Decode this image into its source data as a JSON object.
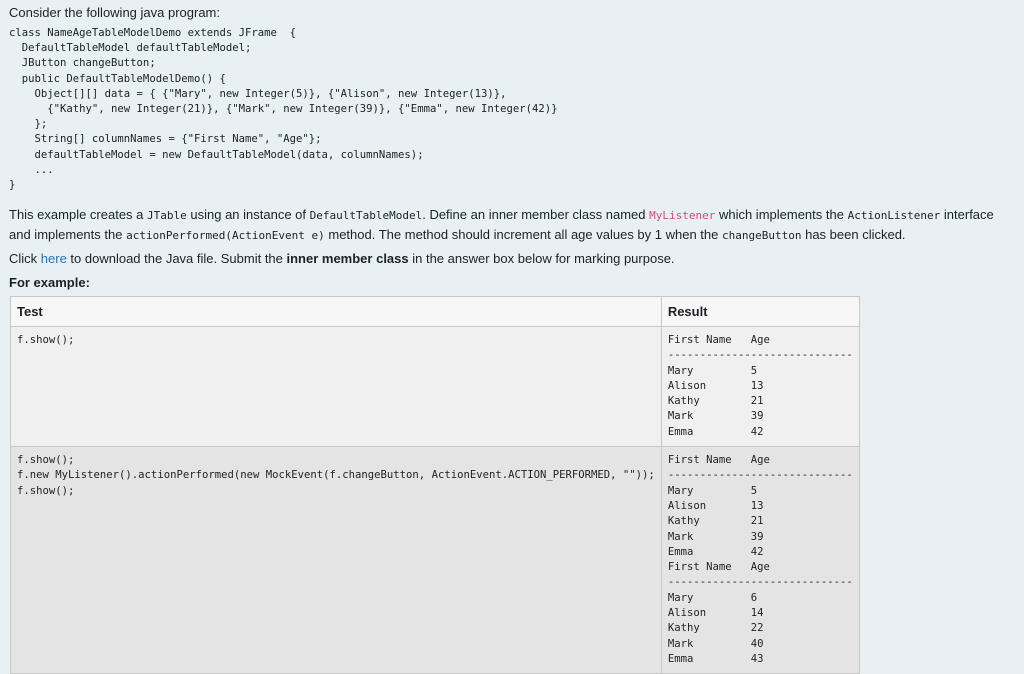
{
  "intro": "Consider the following java program:",
  "code_lines": [
    "class NameAgeTableModelDemo extends JFrame  {",
    "  DefaultTableModel defaultTableModel;",
    "  JButton changeButton;",
    "  public DefaultTableModelDemo() {",
    "    Object[][] data = { {\"Mary\", new Integer(5)}, {\"Alison\", new Integer(13)},",
    "      {\"Kathy\", new Integer(21)}, {\"Mark\", new Integer(39)}, {\"Emma\", new Integer(42)}",
    "    };",
    "    String[] columnNames = {\"First Name\", \"Age\"};",
    "    defaultTableModel = new DefaultTableModel(data, columnNames);",
    "    ...",
    "",
    "}"
  ],
  "para1": {
    "t1": "This example creates a ",
    "c1": "JTable",
    "t2": " using an instance of ",
    "c2": "DefaultTableModel",
    "t3": ". Define an inner member class named ",
    "c3": "MyListener",
    "t4": " which implements the ",
    "c4": "ActionListener",
    "t5": " interface and implements the ",
    "c5": "actionPerformed(ActionEvent e)",
    "t6": " method. The method should increment all age values by 1 when the ",
    "c6": "changeButton",
    "t7": " has been clicked."
  },
  "para2": {
    "t1": "Click ",
    "link": "here",
    "t2": " to download the Java file. Submit the ",
    "bold": "inner member class",
    "t3": " in the answer box below for marking purpose."
  },
  "for_example": "For example:",
  "table": {
    "headers": [
      "Test",
      "Result"
    ],
    "rows": [
      {
        "test": "f.show();",
        "result": "First Name   Age\n-----------------------------\nMary         5\nAlison       13\nKathy        21\nMark         39\nEmma         42"
      },
      {
        "test": "f.show();\nf.new MyListener().actionPerformed(new MockEvent(f.changeButton, ActionEvent.ACTION_PERFORMED, \"\"));\nf.show();",
        "result": "First Name   Age\n-----------------------------\nMary         5\nAlison       13\nKathy        21\nMark         39\nEmma         42\nFirst Name   Age\n-----------------------------\nMary         6\nAlison       14\nKathy        22\nMark         40\nEmma         43"
      }
    ]
  }
}
